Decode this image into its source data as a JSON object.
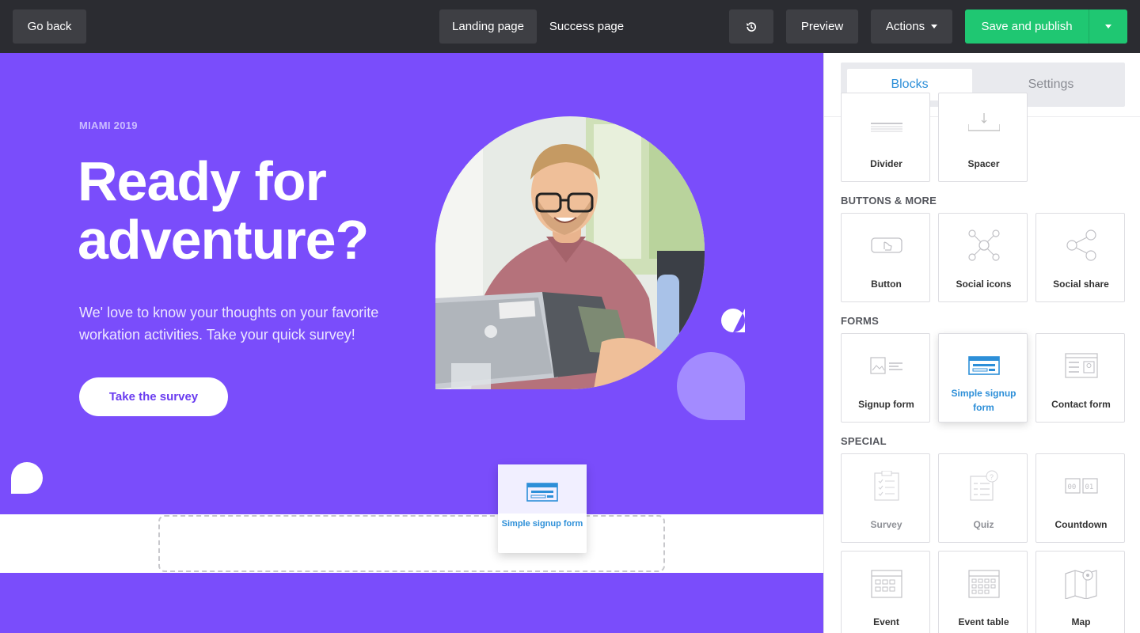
{
  "topbar": {
    "go_back": "Go back",
    "tab_landing": "Landing page",
    "tab_success": "Success page",
    "preview": "Preview",
    "actions": "Actions",
    "save_publish": "Save and publish"
  },
  "hero": {
    "eyebrow": "MIAMI 2019",
    "title": "Ready for adventure?",
    "text": "We' love to know your thoughts on your favorite workation activities. Take your quick survey!",
    "cta": "Take the survey"
  },
  "drag_card": {
    "label": "Simple signup form"
  },
  "sidebar": {
    "tab_blocks": "Blocks",
    "tab_settings": "Settings",
    "top_tiles": [
      "Divider",
      "Spacer"
    ],
    "sections": [
      {
        "title": "BUTTONS & MORE",
        "tiles": [
          "Button",
          "Social icons",
          "Social share"
        ]
      },
      {
        "title": "FORMS",
        "tiles": [
          "Signup form",
          "Simple signup form",
          "Contact form"
        ]
      },
      {
        "title": "SPECIAL",
        "tiles": [
          "Survey",
          "Quiz",
          "Countdown",
          "Event",
          "Event table",
          "Map"
        ]
      }
    ]
  },
  "colors": {
    "accent": "#7a4dfb",
    "publish": "#1fc772",
    "link_blue": "#2d8fd8"
  }
}
